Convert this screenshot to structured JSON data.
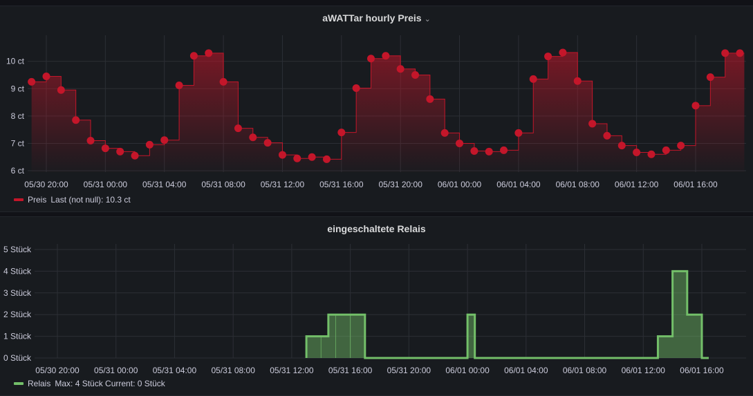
{
  "panels": {
    "price": {
      "title": "aWATTar hourly Preis",
      "legend_name": "Preis",
      "legend_stat": "Last (not null): 10.3 ct",
      "color": "#c4162a"
    },
    "relays": {
      "title": "eingeschaltete Relais",
      "legend_name": "Relais",
      "legend_stat": "Max: 4 Stück  Current: 0 Stück",
      "color": "#73bf69"
    }
  },
  "chart_data": [
    {
      "type": "line",
      "title": "aWATTar hourly Preis",
      "step": true,
      "points_visible": true,
      "grid": true,
      "legend_placement": "bottom-left",
      "x_tick_labels": [
        "05/30 20:00",
        "05/31 00:00",
        "05/31 04:00",
        "05/31 08:00",
        "05/31 12:00",
        "05/31 16:00",
        "05/31 20:00",
        "06/01 00:00",
        "06/01 04:00",
        "06/01 08:00",
        "06/01 12:00",
        "06/01 16:00"
      ],
      "y_tick_labels": [
        "6 ct",
        "7 ct",
        "8 ct",
        "9 ct",
        "10 ct"
      ],
      "y_ticks": [
        6,
        7,
        8,
        9,
        10
      ],
      "ylim": [
        5.95,
        10.75
      ],
      "x_hours_range": [
        -0.4,
        48.8
      ],
      "series": [
        {
          "name": "Preis",
          "color": "#c4162a",
          "x": [
            "05/30 19:00",
            "05/30 20:00",
            "05/30 21:00",
            "05/30 22:00",
            "05/30 23:00",
            "05/31 00:00",
            "05/31 01:00",
            "05/31 02:00",
            "05/31 03:00",
            "05/31 04:00",
            "05/31 05:00",
            "05/31 06:00",
            "05/31 07:00",
            "05/31 08:00",
            "05/31 09:00",
            "05/31 10:00",
            "05/31 11:00",
            "05/31 12:00",
            "05/31 13:00",
            "05/31 14:00",
            "05/31 15:00",
            "05/31 16:00",
            "05/31 17:00",
            "05/31 18:00",
            "05/31 19:00",
            "05/31 20:00",
            "05/31 21:00",
            "05/31 22:00",
            "05/31 23:00",
            "06/01 00:00",
            "06/01 01:00",
            "06/01 02:00",
            "06/01 03:00",
            "06/01 04:00",
            "06/01 05:00",
            "06/01 06:00",
            "06/01 07:00",
            "06/01 08:00",
            "06/01 09:00",
            "06/01 10:00",
            "06/01 11:00",
            "06/01 12:00",
            "06/01 13:00",
            "06/01 14:00",
            "06/01 15:00",
            "06/01 16:00",
            "06/01 17:00",
            "06/01 18:00",
            "06/01 19:00"
          ],
          "values": [
            9.25,
            9.45,
            8.95,
            7.85,
            7.1,
            6.82,
            6.7,
            6.55,
            6.95,
            7.12,
            9.12,
            10.2,
            10.3,
            9.25,
            7.55,
            7.22,
            7.02,
            6.58,
            6.45,
            6.5,
            6.42,
            7.4,
            9.02,
            10.1,
            10.2,
            9.72,
            9.5,
            8.62,
            7.38,
            7.0,
            6.72,
            6.7,
            6.75,
            7.38,
            9.35,
            10.18,
            10.32,
            9.28,
            7.72,
            7.28,
            6.92,
            6.67,
            6.6,
            6.75,
            6.92,
            8.38,
            9.42,
            10.3,
            10.3
          ]
        }
      ]
    },
    {
      "type": "line",
      "title": "eingeschaltete Relais",
      "step": true,
      "fill": true,
      "grid": true,
      "legend_placement": "bottom-left",
      "x_tick_labels": [
        "05/30 20:00",
        "05/31 00:00",
        "05/31 04:00",
        "05/31 08:00",
        "05/31 12:00",
        "05/31 16:00",
        "05/31 20:00",
        "06/01 00:00",
        "06/01 04:00",
        "06/01 08:00",
        "06/01 12:00",
        "06/01 16:00"
      ],
      "y_tick_labels": [
        "0 Stück",
        "1 Stück",
        "2 Stück",
        "3 Stück",
        "4 Stück",
        "5 Stück"
      ],
      "y_ticks": [
        0,
        1,
        2,
        3,
        4,
        5
      ],
      "ylim": [
        0,
        5
      ],
      "x_hours_range": [
        -0.4,
        48.8
      ],
      "series": [
        {
          "name": "Relais",
          "color": "#73bf69",
          "x": [
            "05/31 13:00",
            "05/31 14:30",
            "05/31 17:00",
            "06/01 00:00",
            "06/01 00:30",
            "06/01 13:00",
            "06/01 14:00",
            "06/01 15:00",
            "06/01 16:00"
          ],
          "values": [
            1,
            2,
            0,
            2,
            0,
            1,
            4,
            2,
            0
          ]
        }
      ]
    }
  ]
}
